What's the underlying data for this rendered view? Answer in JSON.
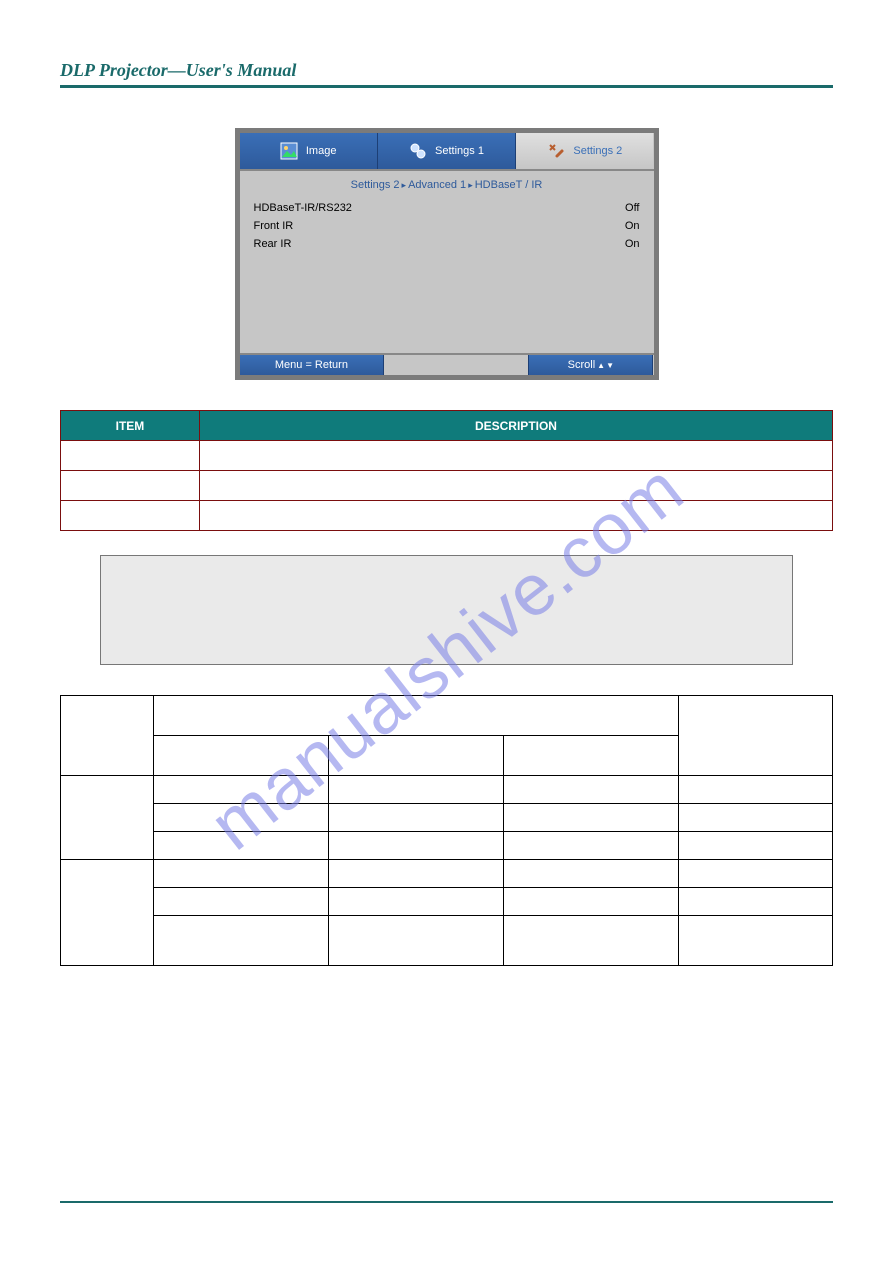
{
  "header": {
    "title": "DLP Projector—User's Manual"
  },
  "footer": {
    "page": ""
  },
  "watermark": "manualshive.com",
  "osd": {
    "tabs": {
      "t1": "Image",
      "t2": "Settings 1",
      "t3": "Settings 2"
    },
    "breadcrumb": {
      "a": "Settings 2",
      "b": "Advanced 1",
      "c": "HDBaseT / IR"
    },
    "rows": [
      {
        "label": "HDBaseT-IR/RS232",
        "value": "Off"
      },
      {
        "label": "Front IR",
        "value": "On"
      },
      {
        "label": "Rear IR",
        "value": "On"
      }
    ],
    "footer": {
      "left": "Menu = Return",
      "mid": "",
      "right": "Scroll"
    }
  },
  "descTable": {
    "head": {
      "c1": "ITEM",
      "c2": "DESCRIPTION"
    },
    "rows": [
      {
        "c1": "",
        "c2": ""
      },
      {
        "c1": "",
        "c2": ""
      },
      {
        "c1": "",
        "c2": ""
      }
    ]
  },
  "note": {
    "text": ""
  },
  "funcTable": {
    "head": {
      "r1c1": "",
      "r1c2": "",
      "r1c3": "",
      "r2c1": "",
      "r2c2": "",
      "r2c3": ""
    },
    "groups": [
      {
        "groupLabel": "",
        "rows": [
          {
            "a": "",
            "b": "",
            "c": "",
            "d": ""
          },
          {
            "a": "",
            "b": "",
            "c": "",
            "d": ""
          },
          {
            "a": "",
            "b": "",
            "c": "",
            "d": ""
          }
        ]
      },
      {
        "groupLabel": "",
        "rows": [
          {
            "a": "",
            "b": "",
            "c": "",
            "d": ""
          },
          {
            "a": "",
            "b": "",
            "c": "",
            "d": ""
          },
          {
            "a": "",
            "b": "",
            "c": "",
            "d": ""
          }
        ]
      }
    ]
  }
}
